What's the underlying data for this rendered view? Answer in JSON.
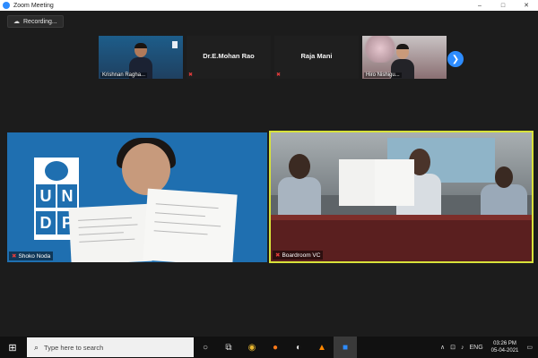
{
  "window": {
    "title": "Zoom Meeting",
    "controls": [
      "–",
      "□",
      "✕"
    ]
  },
  "recording": {
    "label": "Recording..."
  },
  "thumbnails": [
    {
      "id": "krishnan",
      "caption": "Krishnan Ragha..."
    },
    {
      "id": "mohan",
      "name": "Dr.E.Mohan Rao"
    },
    {
      "id": "raja",
      "name": "Raja Mani"
    },
    {
      "id": "hiro",
      "caption": "Hiro Nishigu..."
    }
  ],
  "next_arrow": "❯",
  "tiles": {
    "shoko": {
      "label": "Shoko Noda"
    },
    "boardroom": {
      "label": "Boardroom VC"
    }
  },
  "undp_letters": [
    "U",
    "N",
    "D",
    "P"
  ],
  "taskbar": {
    "search_placeholder": "Type here to search",
    "language": "ENG",
    "time": "03:26 PM",
    "date": "05-04-2021"
  },
  "colors": {
    "zoom_blue": "#2d8cff",
    "active_speaker": "#d8e23a",
    "muted": "#e23c3c"
  }
}
